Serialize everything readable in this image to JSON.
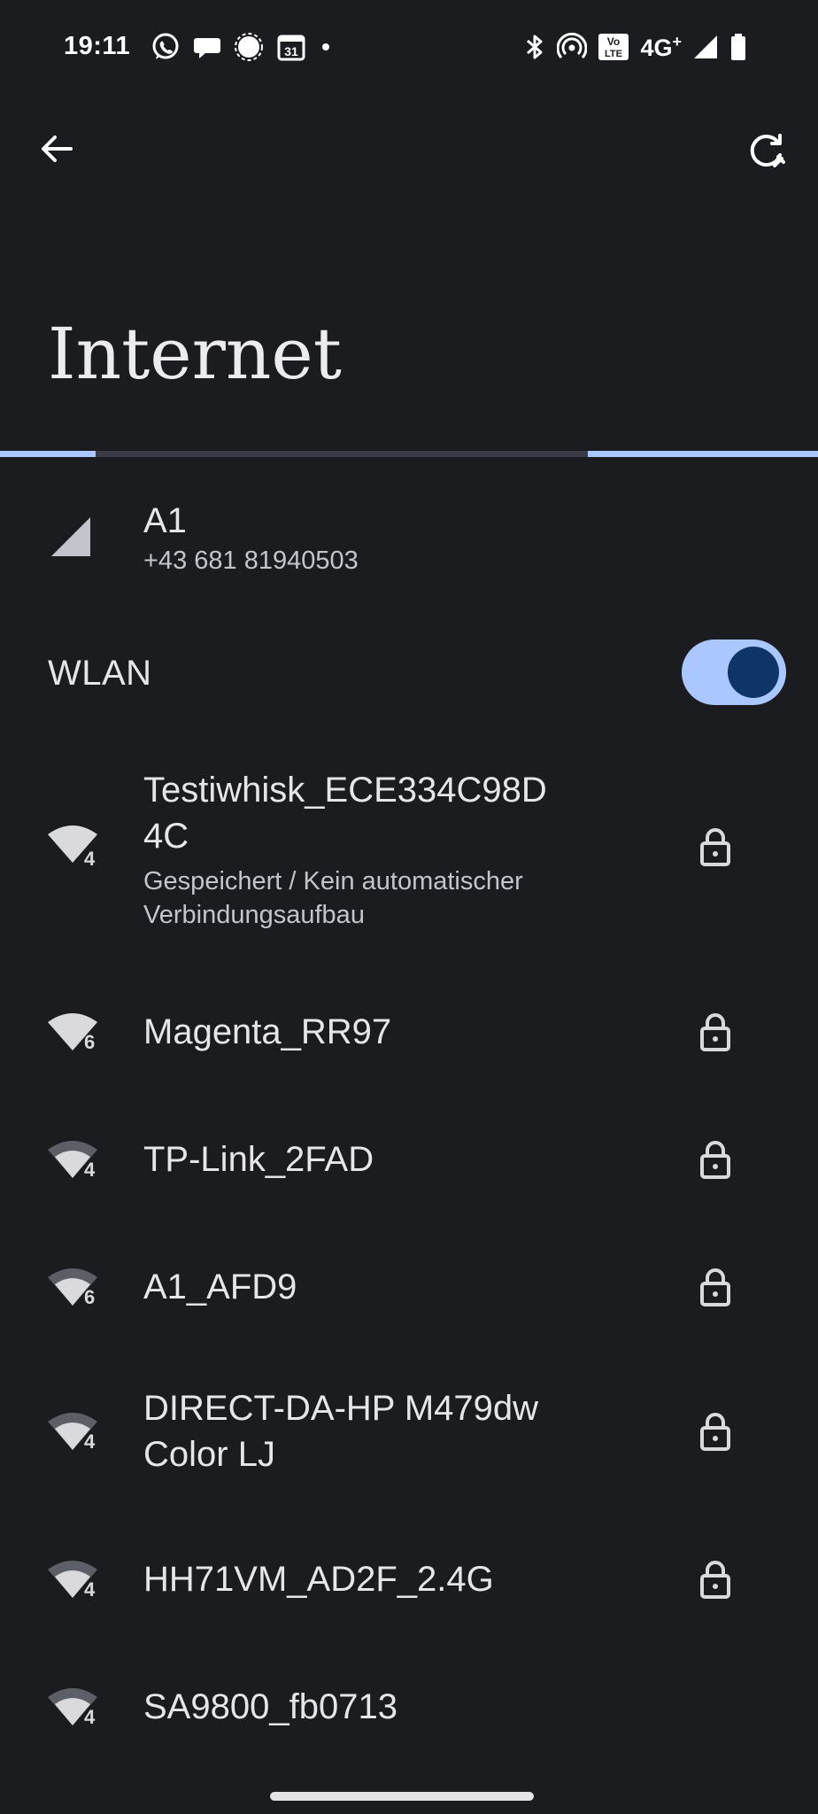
{
  "status_bar": {
    "time": "19:11",
    "left_icons": [
      "whatsapp-icon",
      "chat-bubble-icon",
      "signal-messenger-icon",
      "calendar-icon",
      "dot-icon"
    ],
    "calendar_day": "31",
    "right_icons": [
      "bluetooth-icon",
      "hotspot-icon",
      "volte-icon",
      "network-type",
      "cell-signal-icon",
      "battery-icon"
    ],
    "volte_label_top": "Vo",
    "volte_label_bottom": "LTE",
    "network_type": "4G",
    "network_type_sup": "+"
  },
  "toolbar": {
    "back_icon": "arrow-back-icon",
    "refresh_icon": "refresh-icon"
  },
  "page": {
    "title": "Internet",
    "loading_progress": "indeterminate"
  },
  "mobile": {
    "carrier": "A1",
    "number": "+43 681 81940503",
    "icon": "cell-signal-icon"
  },
  "wlan": {
    "label": "WLAN",
    "enabled": true
  },
  "networks": [
    {
      "name_line1": "Testiwhisk_ECE334C98D",
      "name_line2": "4C",
      "status_line1": "Gespeichert / Kein automatischer",
      "status_line2": "Verbindungsaufbau",
      "badge": "4",
      "secured": true
    },
    {
      "name": "Magenta_RR97",
      "badge": "6",
      "secured": true
    },
    {
      "name": "TP-Link_2FAD",
      "badge": "4",
      "secured": true
    },
    {
      "name": "A1_AFD9",
      "badge": "6",
      "secured": true
    },
    {
      "name_line1": "DIRECT-DA-HP M479dw",
      "name_line2": "Color LJ",
      "badge": "4",
      "secured": true
    },
    {
      "name": "HH71VM_AD2F_2.4G",
      "badge": "4",
      "secured": true
    },
    {
      "name": "SA9800_fb0713",
      "badge": "4",
      "secured": false
    }
  ],
  "colors": {
    "background": "#1b1c20",
    "accent": "#aac7ff",
    "switch_knob": "#0f3467",
    "text_primary": "#e6e5ea",
    "text_secondary": "#c3c4cc"
  }
}
